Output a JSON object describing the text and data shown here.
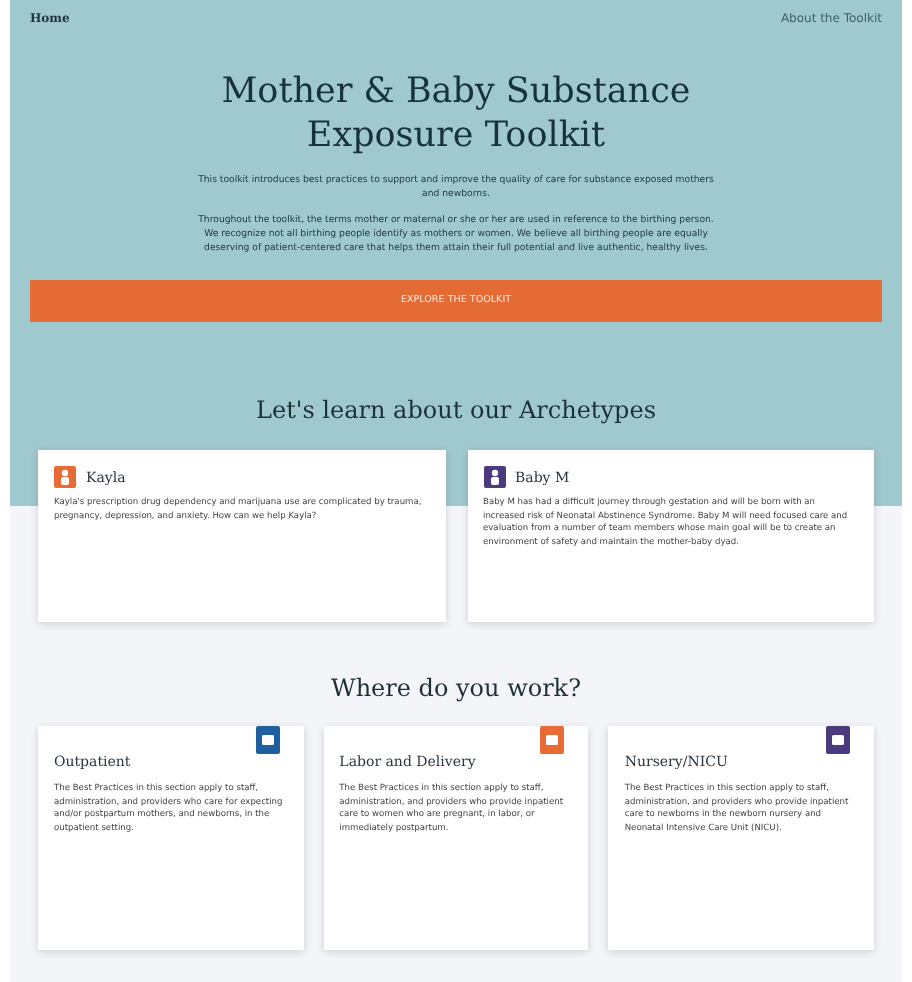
{
  "nav": {
    "home": "Home",
    "about": "About the Toolkit"
  },
  "hero": {
    "title": "Mother & Baby Substance Exposure Toolkit",
    "paragraphs": [
      "This toolkit introduces best practices to support and improve the quality of care for substance exposed mothers and newborns.",
      "Throughout the toolkit, the terms mother or maternal or she or her are used in reference to the birthing person. We recognize not all birthing people identify as mothers or women. We believe all birthing people are equally deserving of patient-centered care that helps them attain their full potential and live authentic, healthy lives."
    ],
    "button": "EXPLORE THE TOOLKIT"
  },
  "archetypes": {
    "heading": "Let's learn about our Archetypes",
    "cards": [
      {
        "name": "Kayla",
        "color": "#e86a35",
        "text": "Kayla's prescription drug dependency and marijuana use are complicated by trauma, pregnancy, depression, and anxiety. How can we help Kayla?"
      },
      {
        "name": "Baby M",
        "color": "#4b3a7e",
        "text": "Baby M has had a difficult journey through gestation and will be born with an increased risk of Neonatal Abstinence Syndrome. Baby M will need focused care and evaluation from a number of team members whose main goal will be to create an environment of safety and maintain the mother-baby dyad."
      }
    ]
  },
  "workplaces": {
    "heading": "Where do you work?",
    "cards": [
      {
        "name": "Outpatient",
        "color": "#1f5f9e",
        "text": "The Best Practices in this section apply to staff, administration, and providers who care for expecting and/or postpartum mothers, and newborns, in the outpatient setting."
      },
      {
        "name": "Labor and Delivery",
        "color": "#e86a35",
        "text": "The Best Practices in this section apply to staff, administration, and providers who provide inpatient care to women who are pregnant, in labor, or immediately postpartum."
      },
      {
        "name": "Nursery/NICU",
        "color": "#4b3a7e",
        "text": "The Best Practices in this section apply to staff, administration, and providers who provide inpatient care to newborns in the newborn nursery and Neonatal Intensive Care Unit (NICU)."
      }
    ]
  }
}
